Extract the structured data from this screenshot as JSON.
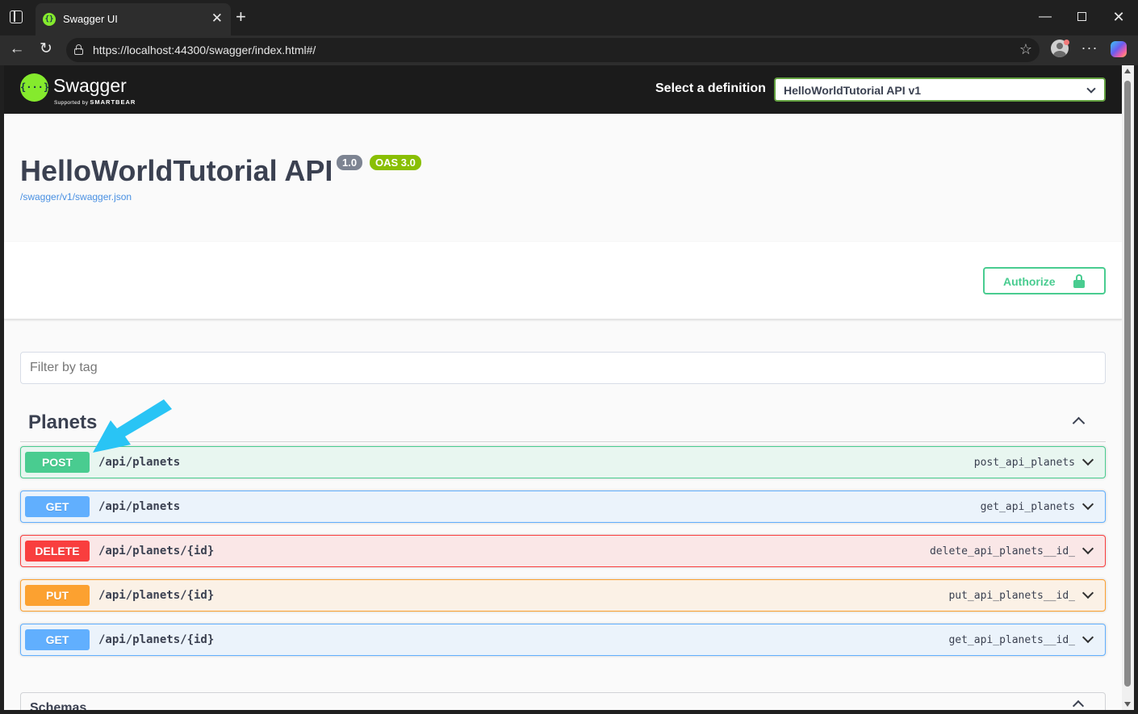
{
  "browser": {
    "tab_title": "Swagger UI",
    "url": "https://localhost:44300/swagger/index.html#/",
    "icons": {
      "sidebar": "sidebar-icon",
      "favicon": "swagger-favicon",
      "tab_close": "close-icon",
      "new_tab": "plus-icon",
      "back": "arrow-left-icon",
      "reload": "reload-icon",
      "lock": "lock-icon",
      "favorite": "star-icon",
      "profile": "profile-icon",
      "more": "more-icon",
      "copilot": "copilot-icon"
    }
  },
  "swagger": {
    "logo": {
      "name": "Swagger",
      "supported_by": "Supported by",
      "company": "SMARTBEAR"
    },
    "select_definition_label": "Select a definition",
    "selected_definition": "HelloWorldTutorial API v1",
    "info": {
      "title": "HelloWorldTutorial API",
      "version": "1.0",
      "oas_badge": "OAS 3.0",
      "spec_link": "/swagger/v1/swagger.json"
    },
    "authorize_label": "Authorize",
    "filter_placeholder": "Filter by tag",
    "tag": {
      "name": "Planets",
      "operations": [
        {
          "method": "POST",
          "path": "/api/planets",
          "operation_id": "post_api_planets"
        },
        {
          "method": "GET",
          "path": "/api/planets",
          "operation_id": "get_api_planets"
        },
        {
          "method": "DELETE",
          "path": "/api/planets/{id}",
          "operation_id": "delete_api_planets__id_"
        },
        {
          "method": "PUT",
          "path": "/api/planets/{id}",
          "operation_id": "put_api_planets__id_"
        },
        {
          "method": "GET",
          "path": "/api/planets/{id}",
          "operation_id": "get_api_planets__id_"
        }
      ]
    },
    "schemas_title": "Schemas"
  },
  "colors": {
    "post": "#49cc90",
    "get": "#61affe",
    "delete": "#f93e3e",
    "put": "#fca130",
    "annotation_arrow": "#29c4f5",
    "swagger_green": "#85ea2d"
  }
}
